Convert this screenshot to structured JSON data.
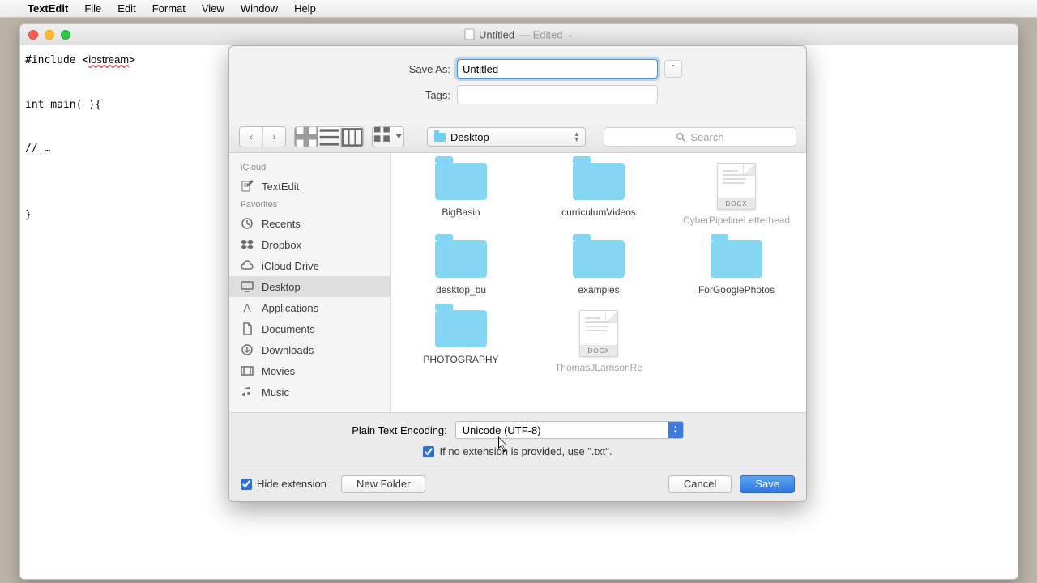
{
  "menubar": {
    "app": "TextEdit",
    "items": [
      "File",
      "Edit",
      "Format",
      "View",
      "Window",
      "Help"
    ]
  },
  "window": {
    "title": "Untitled",
    "edited_suffix": " — Edited",
    "code": "#include <iostream>\n\nint main( ){\n\n// …\n\n\n}"
  },
  "dialog": {
    "save_as_label": "Save As:",
    "save_as_value": "Untitled",
    "tags_label": "Tags:",
    "location": "Desktop",
    "search_placeholder": "Search",
    "sidebar": {
      "sections": [
        {
          "heading": "iCloud",
          "items": [
            {
              "icon": "textedit",
              "label": "TextEdit"
            }
          ]
        },
        {
          "heading": "Favorites",
          "items": [
            {
              "icon": "recents",
              "label": "Recents"
            },
            {
              "icon": "dropbox",
              "label": "Dropbox"
            },
            {
              "icon": "cloud",
              "label": "iCloud Drive"
            },
            {
              "icon": "desktop",
              "label": "Desktop",
              "selected": true
            },
            {
              "icon": "apps",
              "label": "Applications"
            },
            {
              "icon": "docs",
              "label": "Documents"
            },
            {
              "icon": "downloads",
              "label": "Downloads"
            },
            {
              "icon": "movies",
              "label": "Movies"
            },
            {
              "icon": "music",
              "label": "Music"
            }
          ]
        }
      ]
    },
    "grid": [
      {
        "type": "folder",
        "label": "BigBasin"
      },
      {
        "type": "folder",
        "label": "curriculumVideos"
      },
      {
        "type": "docx",
        "label": "CyberPipelineLetterhead",
        "dimmed": true
      },
      {
        "type": "folder",
        "label": "desktop_bu"
      },
      {
        "type": "folder",
        "label": "examples"
      },
      {
        "type": "folder",
        "label": "ForGooglePhotos"
      },
      {
        "type": "folder",
        "label": "PHOTOGRAPHY"
      },
      {
        "type": "docx",
        "label": "ThomasJLarrisonRe",
        "dimmed": true
      }
    ],
    "encoding_label": "Plain Text Encoding:",
    "encoding_value": "Unicode (UTF-8)",
    "ext_checkbox": "If no extension is provided, use \".txt\".",
    "hide_ext": "Hide extension",
    "new_folder": "New Folder",
    "cancel": "Cancel",
    "save": "Save"
  }
}
